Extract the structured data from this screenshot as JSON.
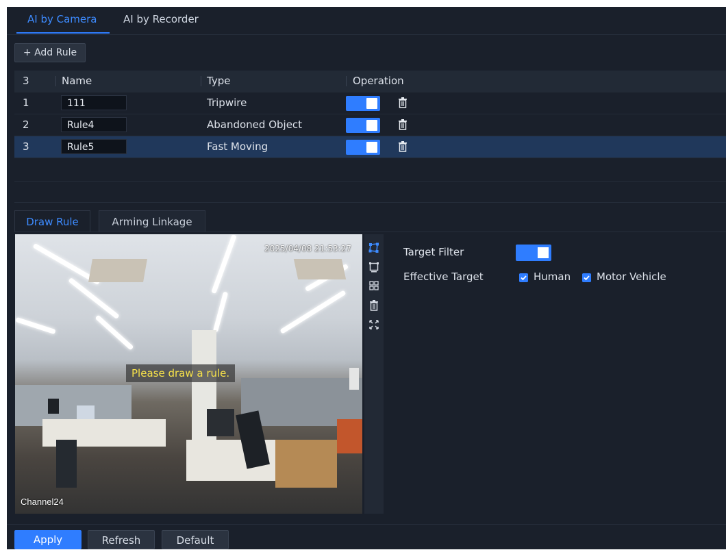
{
  "top_tabs": [
    {
      "label": "AI by Camera",
      "active": true
    },
    {
      "label": "AI by Recorder",
      "active": false
    }
  ],
  "add_rule_label": "+ Add Rule",
  "table": {
    "headers": {
      "index": "3",
      "name": "Name",
      "type": "Type",
      "operation": "Operation"
    },
    "rows": [
      {
        "index": "1",
        "name": "111",
        "type": "Tripwire",
        "enabled": true
      },
      {
        "index": "2",
        "name": "Rule4",
        "type": "Abandoned Object",
        "enabled": true
      },
      {
        "index": "3",
        "name": "Rule5",
        "type": "Fast Moving",
        "enabled": true,
        "selected": true
      }
    ]
  },
  "sub_tabs": [
    {
      "label": "Draw Rule",
      "active": true
    },
    {
      "label": "Arming Linkage",
      "active": false
    }
  ],
  "video": {
    "timestamp": "2025/04/08 21:53:27",
    "channel": "Channel24",
    "prompt": "Please draw a rule."
  },
  "draw_tools": [
    "draw-area-icon",
    "draw-rectangle-icon",
    "draw-target-size-icon",
    "delete-icon",
    "fullscreen-icon"
  ],
  "settings": {
    "target_filter_label": "Target Filter",
    "target_filter_on": true,
    "effective_target_label": "Effective Target",
    "targets": [
      {
        "label": "Human",
        "checked": true
      },
      {
        "label": "Motor Vehicle",
        "checked": true
      }
    ]
  },
  "buttons": {
    "apply": "Apply",
    "refresh": "Refresh",
    "default": "Default"
  },
  "colors": {
    "accent": "#2f7dff",
    "background": "#1a202b",
    "prompt_text": "#f7e24a"
  }
}
